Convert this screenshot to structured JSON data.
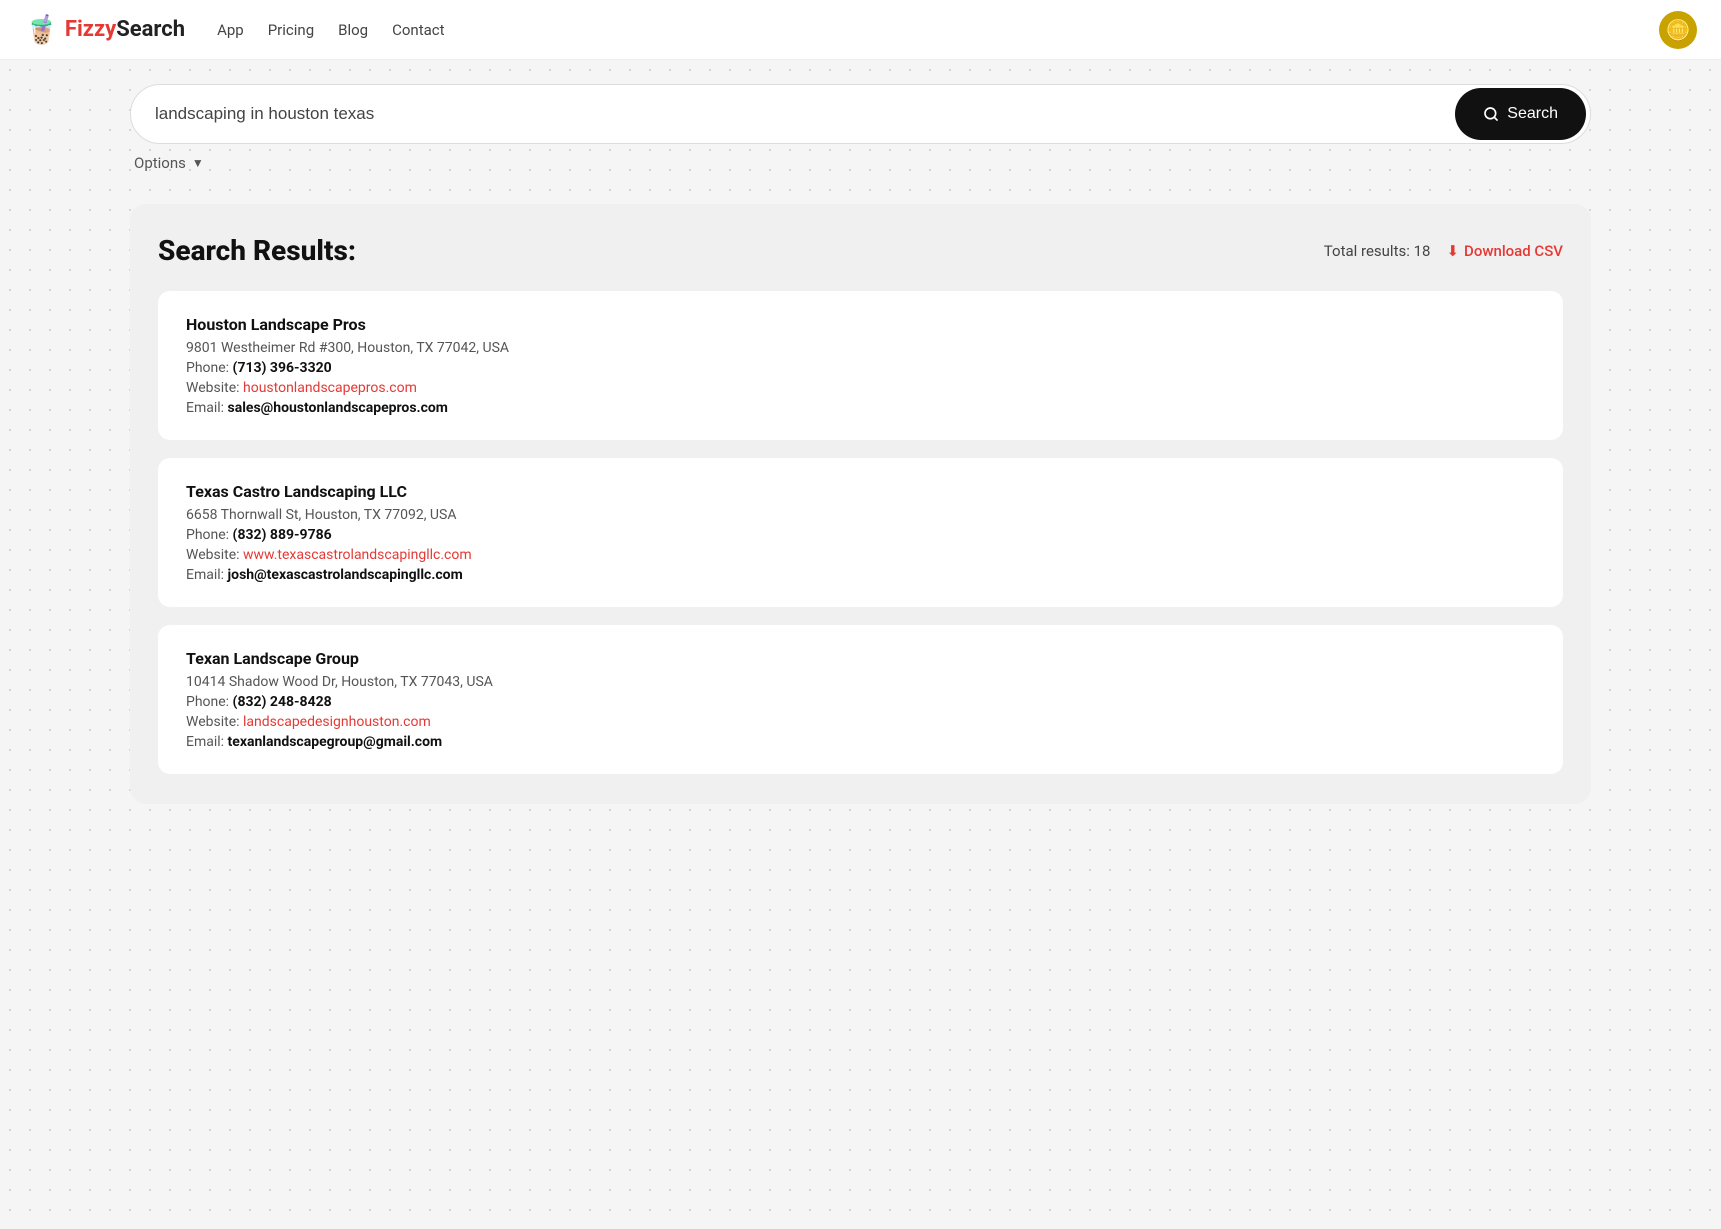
{
  "nav": {
    "logo_icon": "🧋",
    "logo_fizzy": "Fizzy",
    "logo_search": "Search",
    "links": [
      {
        "label": "App",
        "href": "#"
      },
      {
        "label": "Pricing",
        "href": "#"
      },
      {
        "label": "Blog",
        "href": "#"
      },
      {
        "label": "Contact",
        "href": "#"
      }
    ],
    "avatar_icon": "🪙"
  },
  "search": {
    "input_value": "landscaping in houston texas",
    "input_placeholder": "Search...",
    "button_label": "Search",
    "options_label": "Options",
    "options_arrow": "▼"
  },
  "results": {
    "title": "Search Results:",
    "total_label": "Total results:",
    "total_count": "18",
    "download_icon": "⬇",
    "download_label": "Download CSV",
    "cards": [
      {
        "name": "Houston Landscape Pros",
        "address": "9801 Westheimer Rd #300, Houston, TX 77042, USA",
        "phone_label": "Phone:",
        "phone": "(713) 396-3320",
        "website_label": "Website:",
        "website_text": "houstonlandscapepros.com",
        "website_href": "#",
        "email_label": "Email:",
        "email": "sales@houstonlandscapepros.com"
      },
      {
        "name": "Texas Castro Landscaping LLC",
        "address": "6658 Thornwall St, Houston, TX 77092, USA",
        "phone_label": "Phone:",
        "phone": "(832) 889-9786",
        "website_label": "Website:",
        "website_text": "www.texascastrolandscapingllc.com",
        "website_href": "#",
        "email_label": "Email:",
        "email": "josh@texascastrolandscapingllc.com"
      },
      {
        "name": "Texan Landscape Group",
        "address": "10414 Shadow Wood Dr, Houston, TX 77043, USA",
        "phone_label": "Phone:",
        "phone": "(832) 248-8428",
        "website_label": "Website:",
        "website_text": "landscapedesignhouston.com",
        "website_href": "#",
        "email_label": "Email:",
        "email": "texanlandscapegroup@gmail.com"
      }
    ]
  }
}
